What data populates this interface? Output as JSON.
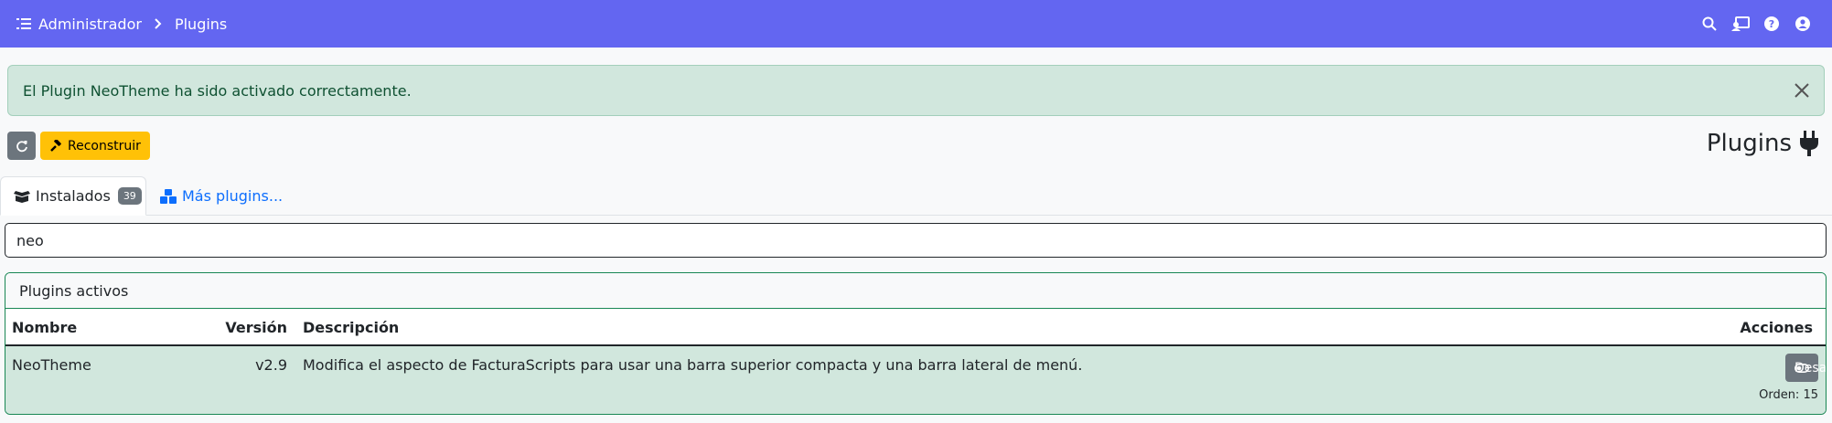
{
  "breadcrumb": {
    "root": "Administrador",
    "current": "Plugins"
  },
  "topbar_icons": [
    "search-icon",
    "user-card-icon",
    "help-icon",
    "user-icon"
  ],
  "alert": {
    "message": "El Plugin NeoTheme ha sido activado correctamente."
  },
  "toolbar": {
    "rebuild_label": "Reconstruir"
  },
  "page": {
    "title": "Plugins"
  },
  "tabs": [
    {
      "label": "Instalados",
      "badge": "39"
    },
    {
      "label": "Más plugins..."
    }
  ],
  "search": {
    "value": "neo"
  },
  "active_plugins": {
    "title": "Plugins activos",
    "columns": {
      "name": "Nombre",
      "version": "Versión",
      "description": "Descripción",
      "actions": "Acciones"
    },
    "rows": [
      {
        "name": "NeoTheme",
        "version": "v2.9",
        "description": "Modifica el aspecto de FacturaScripts para usar una barra superior compacta y una barra lateral de menú.",
        "action_label": "Desactivar",
        "order": "Orden: 15"
      }
    ]
  },
  "colors": {
    "topbar": "#6366f1",
    "alert_bg": "#d1e7dd",
    "rebuild": "#ffc107",
    "secondary": "#6c757d",
    "link": "#0d6efd",
    "card_border": "#198754"
  }
}
